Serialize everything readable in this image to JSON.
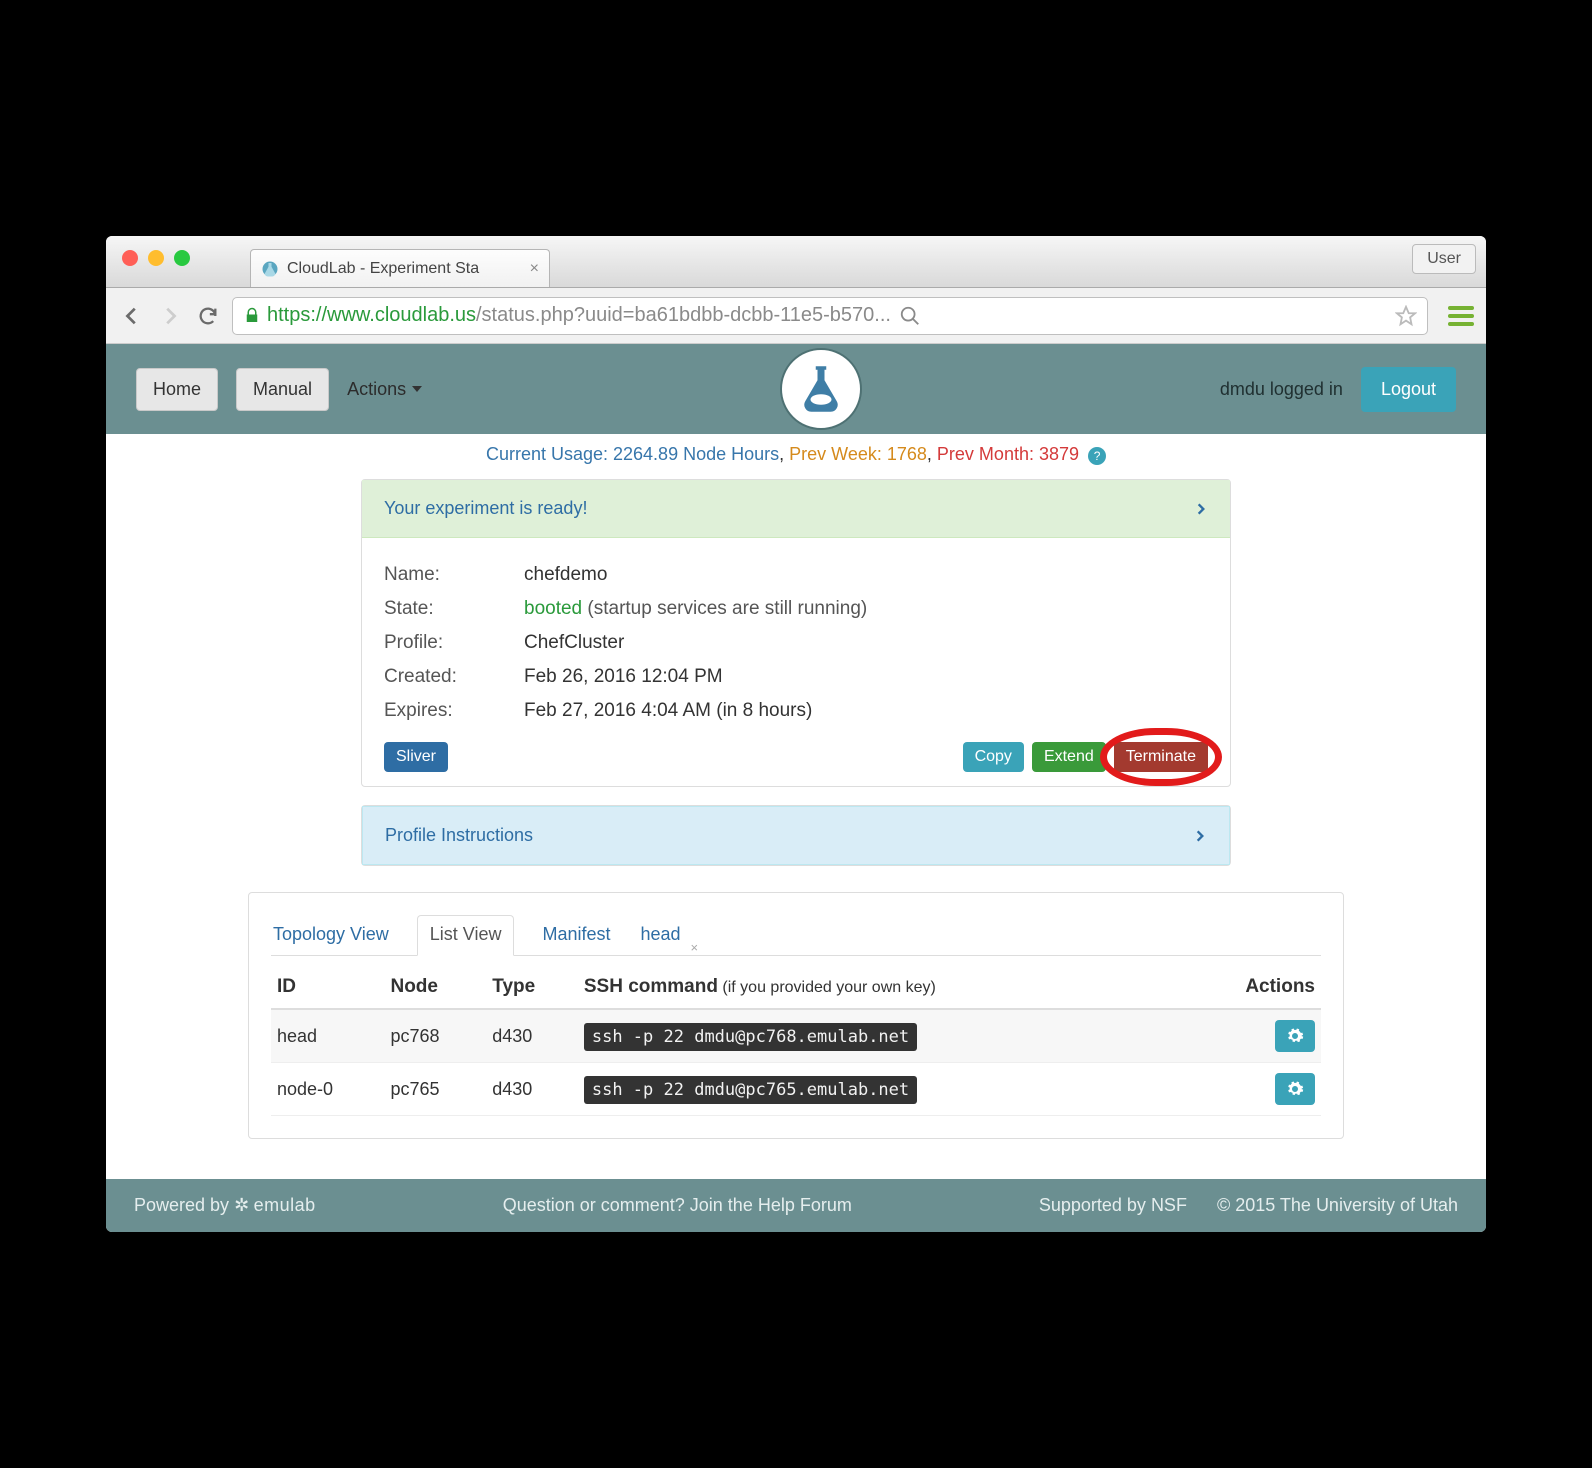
{
  "browser": {
    "tab_title": "CloudLab - Experiment Sta",
    "user_button": "User",
    "url_scheme": "https",
    "url_host": "://www.cloudlab.us",
    "url_path": "/status.php?uuid=ba61bdbb-dcbb-11e5-b570..."
  },
  "nav": {
    "home": "Home",
    "manual": "Manual",
    "actions": "Actions",
    "logged_in": "dmdu logged in",
    "logout": "Logout"
  },
  "usage": {
    "current_label": "Current Usage: ",
    "current_value": "2264.89 Node Hours",
    "sep1": ", ",
    "prev_week_label": "Prev Week: ",
    "prev_week_value": "1768",
    "sep2": ", ",
    "prev_month_label": "Prev Month: ",
    "prev_month_value": "3879"
  },
  "status_panel": {
    "title": "Your experiment is ready!",
    "rows": {
      "name_label": "Name:",
      "name_value": "chefdemo",
      "state_label": "State:",
      "state_value": "booted",
      "state_note": " (startup services are still running)",
      "profile_label": "Profile:",
      "profile_value": "ChefCluster",
      "created_label": "Created:",
      "created_value": "Feb 26, 2016 12:04 PM",
      "expires_label": "Expires:",
      "expires_value": "Feb 27, 2016 4:04 AM (in 8 hours)"
    },
    "buttons": {
      "sliver": "Sliver",
      "copy": "Copy",
      "extend": "Extend",
      "terminate": "Terminate"
    }
  },
  "instructions_panel": {
    "title": "Profile Instructions"
  },
  "tabs": {
    "topology": "Topology View",
    "list": "List View",
    "manifest": "Manifest",
    "head": "head"
  },
  "table": {
    "headers": {
      "id": "ID",
      "node": "Node",
      "type": "Type",
      "ssh": "SSH command",
      "ssh_sub": " (if you provided your own key)",
      "actions": "Actions"
    },
    "rows": [
      {
        "id": "head",
        "node": "pc768",
        "type": "d430",
        "ssh": "ssh -p 22 dmdu@pc768.emulab.net"
      },
      {
        "id": "node-0",
        "node": "pc765",
        "type": "d430",
        "ssh": "ssh -p 22 dmdu@pc765.emulab.net"
      }
    ]
  },
  "footer": {
    "powered_by": "Powered by ",
    "emulab": "emulab",
    "question": "Question or comment? Join the Help Forum",
    "supported": "Supported by NSF",
    "copyright": "© 2015 The University of Utah"
  }
}
